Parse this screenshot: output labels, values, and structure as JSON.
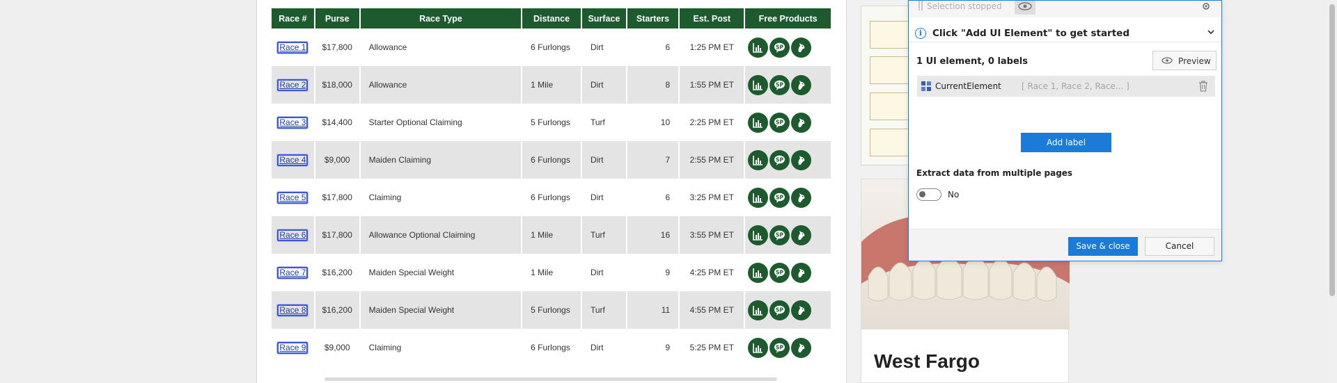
{
  "races_table": {
    "headers": [
      "Race #",
      "Purse",
      "Race Type",
      "Distance",
      "Surface",
      "Starters",
      "Est. Post",
      "Free Products"
    ],
    "rows": [
      {
        "race": "Race 1",
        "purse": "$17,800",
        "type": "Allowance",
        "distance": "6 Furlongs",
        "surface": "Dirt",
        "starters": "6",
        "post": "1:25 PM ET"
      },
      {
        "race": "Race 2",
        "purse": "$18,000",
        "type": "Allowance",
        "distance": "1 Mile",
        "surface": "Dirt",
        "starters": "8",
        "post": "1:55 PM ET"
      },
      {
        "race": "Race 3",
        "purse": "$14,400",
        "type": "Starter Optional Claiming",
        "distance": "5 Furlongs",
        "surface": "Turf",
        "starters": "10",
        "post": "2:25 PM ET"
      },
      {
        "race": "Race 4",
        "purse": "$9,000",
        "type": "Maiden Claiming",
        "distance": "6 Furlongs",
        "surface": "Dirt",
        "starters": "7",
        "post": "2:55 PM ET"
      },
      {
        "race": "Race 5",
        "purse": "$17,800",
        "type": "Claiming",
        "distance": "6 Furlongs",
        "surface": "Dirt",
        "starters": "6",
        "post": "3:25 PM ET"
      },
      {
        "race": "Race 6",
        "purse": "$17,800",
        "type": "Allowance Optional Claiming",
        "distance": "1 Mile",
        "surface": "Turf",
        "starters": "16",
        "post": "3:55 PM ET"
      },
      {
        "race": "Race 7",
        "purse": "$16,200",
        "type": "Maiden Special Weight",
        "distance": "1 Mile",
        "surface": "Dirt",
        "starters": "9",
        "post": "4:25 PM ET"
      },
      {
        "race": "Race 8",
        "purse": "$16,200",
        "type": "Maiden Special Weight",
        "distance": "5 Furlongs",
        "surface": "Turf",
        "starters": "11",
        "post": "4:55 PM ET"
      },
      {
        "race": "Race 9",
        "purse": "$9,000",
        "type": "Claiming",
        "distance": "6 Furlongs",
        "surface": "Dirt",
        "starters": "9",
        "post": "5:25 PM ET"
      }
    ],
    "product_icons": [
      "bar-chart-icon",
      "speech-bubble-icon",
      "horse-head-icon"
    ]
  },
  "ad": {
    "title": "West Fargo"
  },
  "dialog": {
    "selection_status": "Selection stopped",
    "info_text": "Click \"Add UI Element\" to get started",
    "count_text": "1 UI element, 0 labels",
    "preview_label": "Preview",
    "element_name": "CurrentElement",
    "element_values": "[ Race 1, Race 2, Race... ]",
    "add_label": "Add label",
    "multi_page_label": "Extract data from multiple pages",
    "toggle_value": "No",
    "save_label": "Save & close",
    "cancel_label": "Cancel"
  },
  "colors": {
    "table_header": "#1d5b2f",
    "accent_blue": "#1a7bd8"
  }
}
